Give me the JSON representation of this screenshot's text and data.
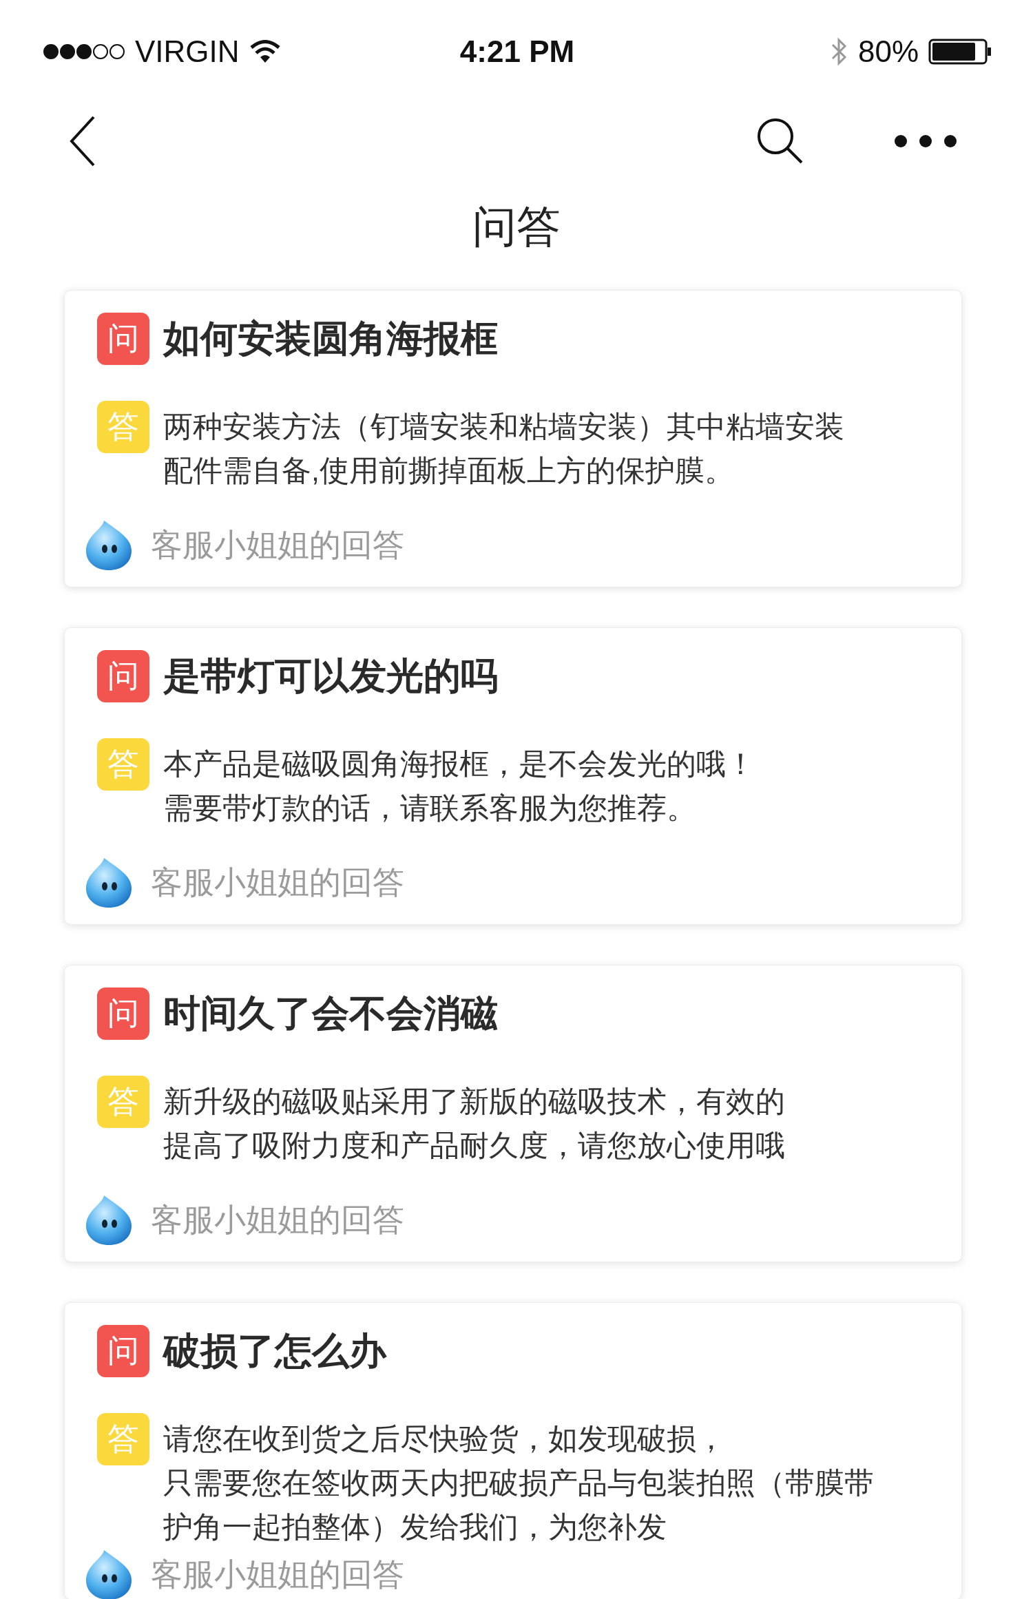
{
  "status_bar": {
    "carrier": "VIRGIN",
    "time": "4:21 PM",
    "battery": "80%"
  },
  "nav": {
    "title": "问答"
  },
  "qa": [
    {
      "q_badge": "问",
      "question": "如何安装圆角海报框",
      "a_badge": "答",
      "answer_lines": [
        "两种安装方法（钉墙安装和粘墙安装）其中粘墙安装",
        "配件需自备,使用前撕掉面板上方的保护膜。"
      ],
      "source": "客服小姐姐的回答"
    },
    {
      "q_badge": "问",
      "question": "是带灯可以发光的吗",
      "a_badge": "答",
      "answer_lines": [
        "本产品是磁吸圆角海报框，是不会发光的哦！",
        "需要带灯款的话，请联系客服为您推荐。"
      ],
      "source": "客服小姐姐的回答"
    },
    {
      "q_badge": "问",
      "question": "时间久了会不会消磁",
      "a_badge": "答",
      "answer_lines": [
        "新升级的磁吸贴采用了新版的磁吸技术，有效的",
        "提高了吸附力度和产品耐久度，请您放心使用哦"
      ],
      "source": "客服小姐姐的回答"
    },
    {
      "q_badge": "问",
      "question": "破损了怎么办",
      "a_badge": "答",
      "answer_lines": [
        "请您在收到货之后尽快验货，如发现破损，",
        "只需要您在签收两天内把破损产品与包装拍照（带膜带",
        "护角一起拍整体）发给我们，为您补发"
      ],
      "source": "客服小姐姐的回答"
    }
  ]
}
